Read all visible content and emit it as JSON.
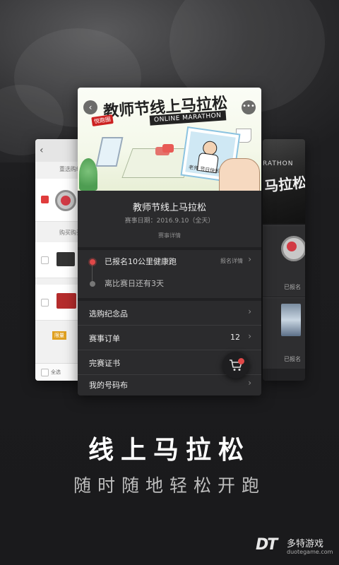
{
  "main_card": {
    "art_title": "教师节线上马拉松",
    "art_subtitle": "ONLINE MARATHON",
    "art_stamp": "悦跑圈",
    "art_photo_caption": "老师 节日快乐",
    "event_title": "教师节线上马拉松",
    "event_date": "赛事日期：2016.9.10（全天）",
    "event_detail_link": "赛事详情",
    "timeline": [
      {
        "text": "已报名10公里健康跑",
        "right": "报名详情"
      },
      {
        "text": "离比赛日还有3天"
      }
    ],
    "menu": [
      {
        "label": "选购纪念品"
      },
      {
        "label": "赛事订单",
        "count": "12"
      },
      {
        "label": "完赛证书"
      },
      {
        "label": "我的号码布"
      }
    ]
  },
  "left_card": {
    "header_row": "重选购纪念",
    "section_row": "购买购买奖牌和",
    "badge": "限量",
    "bottom_text": "全选"
  },
  "right_card": {
    "art_text": "马拉松",
    "art_small": "RATHON",
    "status_1": "已报名",
    "status_2": "已报名"
  },
  "headline": "线上马拉松",
  "subline": "随时随地轻松开跑",
  "watermark": {
    "mark": "DT",
    "name": "多特游戏",
    "url": "duotegame.com"
  },
  "colors": {
    "accent_red": "#e04848",
    "card_bg": "#2b2b2d"
  }
}
